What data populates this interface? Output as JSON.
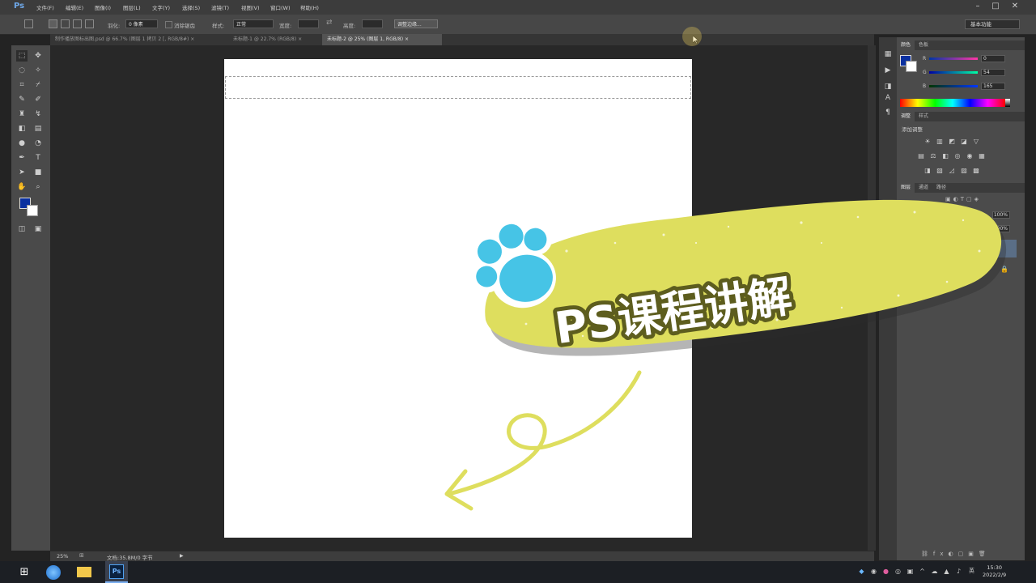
{
  "app": {
    "logo": "Ps"
  },
  "menu": [
    "文件(F)",
    "编辑(E)",
    "图像(I)",
    "图层(L)",
    "文字(Y)",
    "选择(S)",
    "滤镜(T)",
    "视图(V)",
    "窗口(W)",
    "帮助(H)"
  ],
  "window_controls": {
    "minimize": "–",
    "maximize": "□",
    "close": "✕"
  },
  "options_bar": {
    "feather_label": "羽化:",
    "feather_value": "0 像素",
    "antialias_label": "消除锯齿",
    "style_label": "样式:",
    "style_value": "正常",
    "width_label": "宽度:",
    "height_label": "高度:",
    "refine_edge_button": "调整边缘...",
    "workspace_value": "基本功能"
  },
  "document_tabs": [
    {
      "label": "制作播放图标出图.psd @ 66.7% (图层 1 拷贝 2 [, RGB/8#) ×",
      "active": false
    },
    {
      "label": "未标题-1 @ 22.7% (RGB/8) ×",
      "active": false
    },
    {
      "label": "未标题-2 @ 25% (图层 1, RGB/8) ×",
      "active": true
    }
  ],
  "status_bar": {
    "zoom": "25%",
    "doc_info": "文档:35.8M/0 字节"
  },
  "panels": {
    "color_tabs": [
      "颜色",
      "色板"
    ],
    "color_sliders": [
      {
        "label": "R",
        "value": "0"
      },
      {
        "label": "G",
        "value": "54"
      },
      {
        "label": "B",
        "value": "165"
      }
    ],
    "adjust_tabs": [
      "调整",
      "样式"
    ],
    "adjust_title": "添加调整",
    "layers_tabs": [
      "图层",
      "通道",
      "路径"
    ],
    "opacity_value": "100%",
    "fill_value": "100%"
  },
  "overlay": {
    "banner_text": "PS课程讲解",
    "banner_color": "#dede5e",
    "paw_color": "#46c4e6"
  },
  "taskbar": {
    "clock_time": "15:30",
    "clock_date": "2022/2/9",
    "input_method": "英"
  },
  "colors": {
    "foreground": "#0a30a0",
    "background": "#ffffff"
  }
}
